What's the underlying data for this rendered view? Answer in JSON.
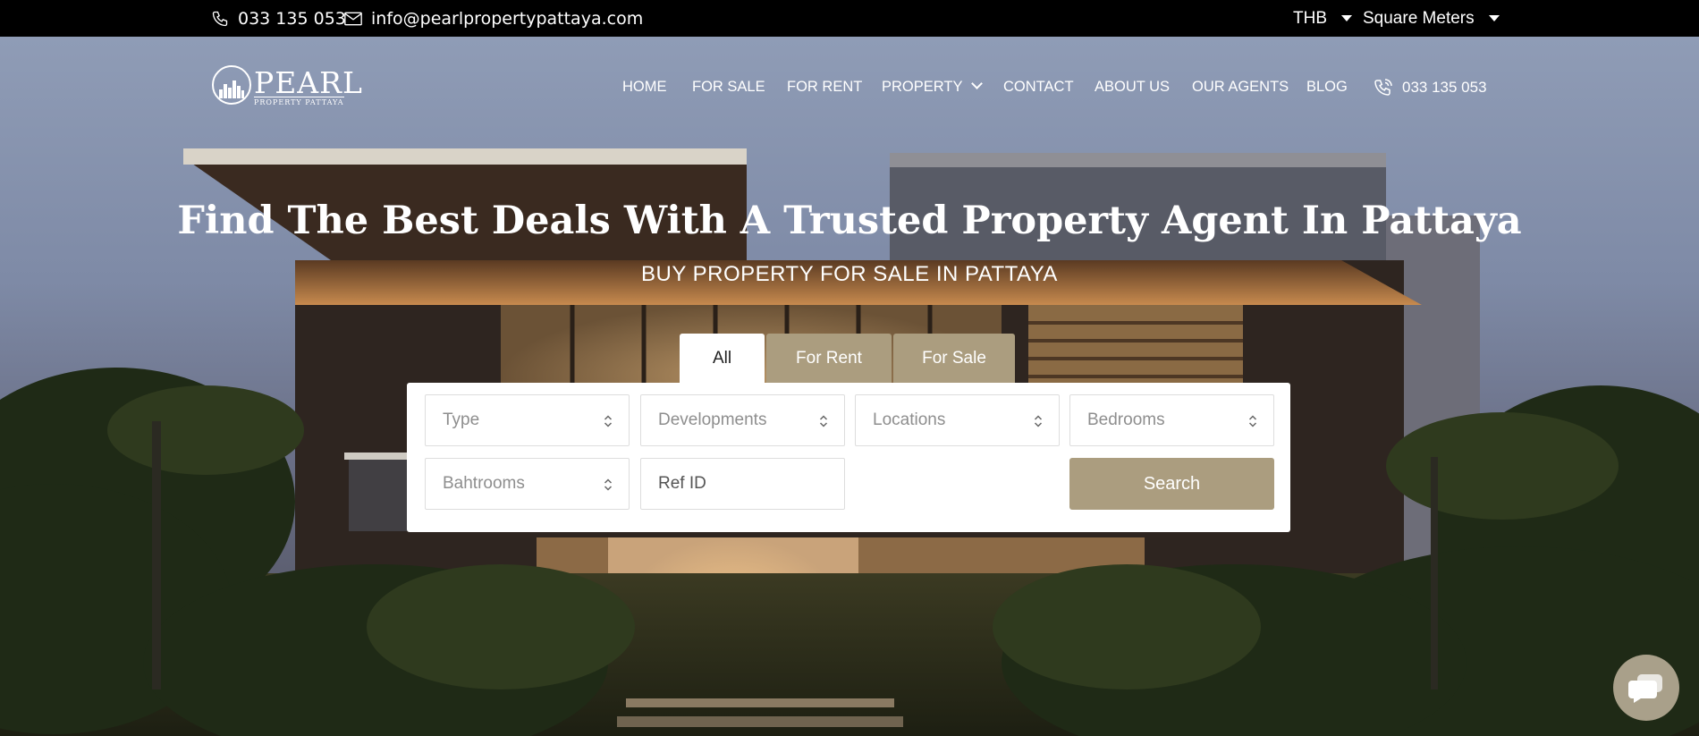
{
  "topbar": {
    "phone": "033 135 053",
    "email": "info@pearlpropertypattaya.com",
    "currency": "THB",
    "area_unit": "Square Meters"
  },
  "logo": {
    "word": "PEARL",
    "sub": "PROPERTY PATTAYA"
  },
  "nav": {
    "items": [
      {
        "label": "HOME"
      },
      {
        "label": "FOR SALE"
      },
      {
        "label": "FOR RENT"
      },
      {
        "label": "PROPERTY"
      },
      {
        "label": "CONTACT"
      },
      {
        "label": "ABOUT US"
      },
      {
        "label": "OUR AGENTS"
      },
      {
        "label": "BLOG"
      }
    ],
    "phone": "033 135 053"
  },
  "hero": {
    "headline": "Find The Best Deals With A Trusted Property Agent In Pattaya",
    "subheadline": "BUY PROPERTY FOR SALE IN PATTAYA"
  },
  "search": {
    "tabs": [
      {
        "label": "All",
        "active": true
      },
      {
        "label": "For Rent",
        "active": false
      },
      {
        "label": "For Sale",
        "active": false
      }
    ],
    "fields": {
      "type": "Type",
      "developments": "Developments",
      "locations": "Locations",
      "bedrooms": "Bedrooms",
      "bathrooms": "Bahtrooms",
      "ref_placeholder": "Ref ID"
    },
    "button": "Search"
  },
  "colors": {
    "accent": "#ab9d7f",
    "topbar_bg": "#000000",
    "chat_bg": "#a9a08a"
  },
  "icons": {
    "topbar_phone": "phone-icon",
    "topbar_email": "envelope-icon",
    "nav_phone": "phone-ringing-icon",
    "chat": "chat-bubble-icon",
    "select": "updown-arrows-icon"
  }
}
